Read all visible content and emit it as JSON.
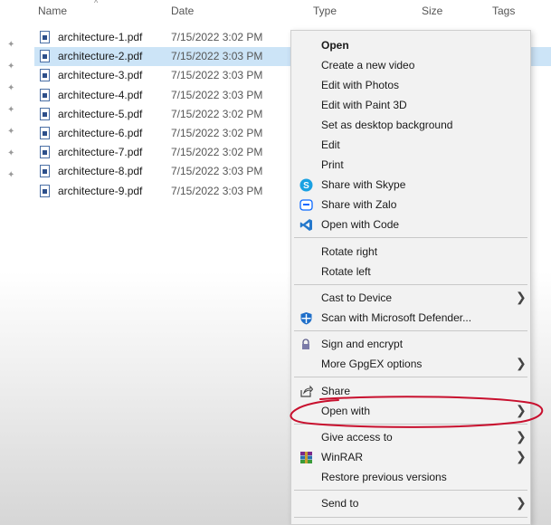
{
  "columns": {
    "name": "Name",
    "date": "Date",
    "type": "Type",
    "size": "Size",
    "tags": "Tags"
  },
  "files": [
    {
      "name": "architecture-1.pdf",
      "date": "7/15/2022 3:02 PM",
      "pinned": true
    },
    {
      "name": "architecture-2.pdf",
      "date": "7/15/2022 3:03 PM",
      "pinned": true,
      "selected": true
    },
    {
      "name": "architecture-3.pdf",
      "date": "7/15/2022 3:03 PM",
      "pinned": true
    },
    {
      "name": "architecture-4.pdf",
      "date": "7/15/2022 3:03 PM",
      "pinned": true
    },
    {
      "name": "architecture-5.pdf",
      "date": "7/15/2022 3:02 PM",
      "pinned": true
    },
    {
      "name": "architecture-6.pdf",
      "date": "7/15/2022 3:02 PM",
      "pinned": true
    },
    {
      "name": "architecture-7.pdf",
      "date": "7/15/2022 3:02 PM",
      "pinned": true
    },
    {
      "name": "architecture-8.pdf",
      "date": "7/15/2022 3:03 PM",
      "pinned": true
    },
    {
      "name": "architecture-9.pdf",
      "date": "7/15/2022 3:03 PM",
      "pinned": false
    }
  ],
  "menu": {
    "open": "Open",
    "create_video": "Create a new video",
    "edit_photos": "Edit with Photos",
    "edit_paint3d": "Edit with Paint 3D",
    "set_background": "Set as desktop background",
    "edit": "Edit",
    "print": "Print",
    "share_skype": "Share with Skype",
    "share_zalo": "Share with Zalo",
    "open_code": "Open with Code",
    "rotate_right": "Rotate right",
    "rotate_left": "Rotate left",
    "cast_device": "Cast to Device",
    "scan_defender": "Scan with Microsoft Defender...",
    "sign_encrypt": "Sign and encrypt",
    "more_gpgex": "More GpgEX options",
    "share": "Share",
    "open_with": "Open with",
    "give_access": "Give access to",
    "winrar": "WinRAR",
    "restore_versions": "Restore previous versions",
    "send_to": "Send to"
  },
  "colors": {
    "selection": "#cce4f7",
    "annotation": "#c8102e",
    "skype": "#1aa1e2",
    "vscode": "#2478cc",
    "defender": "#1f6fc9"
  }
}
